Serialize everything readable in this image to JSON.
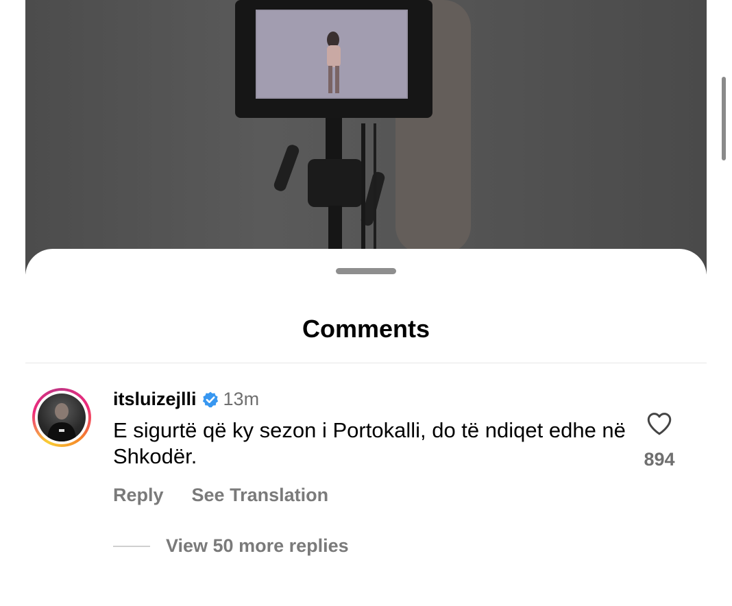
{
  "sheet": {
    "title": "Comments"
  },
  "comment": {
    "username": "itsluizejlli",
    "verified": true,
    "time": "13m",
    "text": "E sigurtë që ky sezon i Portokalli, do të ndiqet edhe në Shkodër.",
    "like_count": "894",
    "reply_label": "Reply",
    "translate_label": "See Translation",
    "more_replies_label": "View 50 more replies"
  },
  "colors": {
    "verified_badge": "#3897f0",
    "secondary_text": "#737373",
    "primary_text": "#000000"
  },
  "icons": {
    "verified": "verified-badge-icon",
    "like": "heart-outline-icon"
  }
}
